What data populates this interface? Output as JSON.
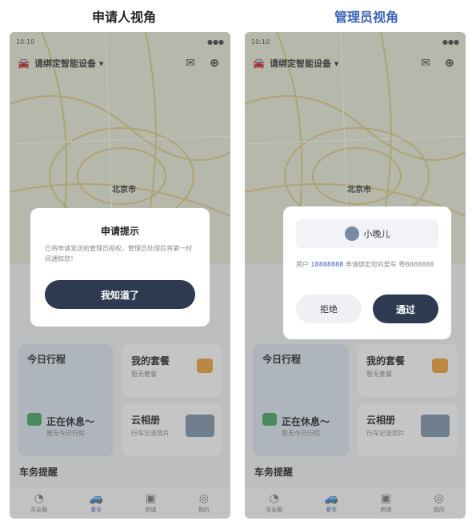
{
  "left": {
    "title": "申请人视角",
    "device_label": "请绑定智能设备 ▾",
    "map_label": "北京市",
    "modal": {
      "title": "申请提示",
      "body": "已将申请发送给管理员授权，管理员处理后将第一时间通知您！",
      "confirm": "我知道了"
    }
  },
  "right": {
    "title": "管理员视角",
    "device_label": "请绑定智能设备 ▾",
    "map_label": "北京市",
    "modal": {
      "user_name": "小晚儿",
      "body_prefix": "用户",
      "body_phone": "18888888",
      "body_suffix": "申请绑定您的爱车 粤B888888",
      "reject": "拒绝",
      "approve": "通过"
    }
  },
  "cards": {
    "today": "今日行程",
    "rest": "正在休息～",
    "rest_sub": "暂无今日行程",
    "package": "我的套餐",
    "package_sub": "暂无套餐",
    "album": "云相册",
    "album_sub": "行车记录照片"
  },
  "section": "车务提醒",
  "tabs": [
    "车友圈",
    "爱车",
    "商城",
    "我的"
  ],
  "colors": {
    "accent": "#3a63b8",
    "primary_btn": "#2e3a52"
  }
}
